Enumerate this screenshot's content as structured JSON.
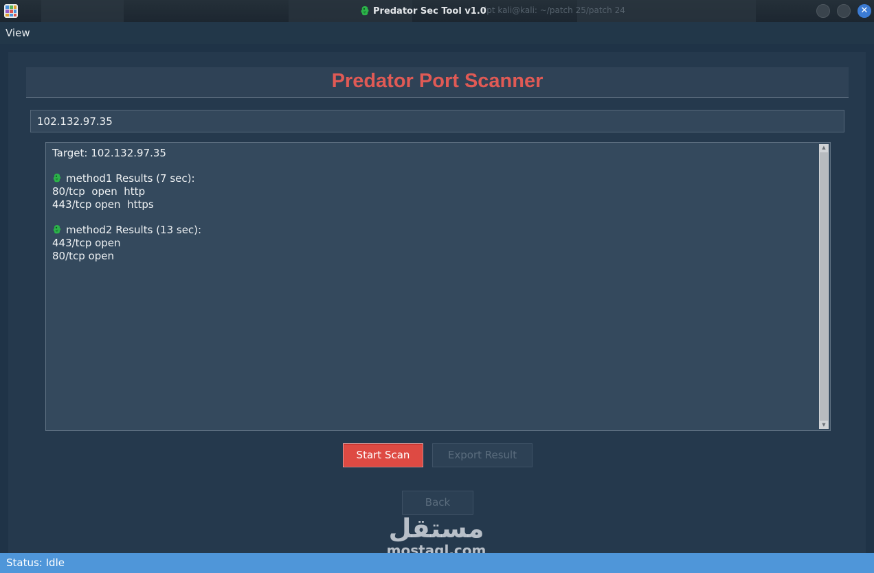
{
  "window": {
    "title": "Predator Sec Tool v1.0",
    "background_title": "ript kali@kali: ~/patch 25/patch 24",
    "close_glyph": "✕"
  },
  "menu": {
    "items": [
      {
        "label": "View"
      }
    ]
  },
  "app": {
    "heading": "Predator Port Scanner"
  },
  "target": {
    "value": "102.132.97.35"
  },
  "output": {
    "lines": [
      {
        "text": "Target: 102.132.97.35",
        "icon": null
      },
      {
        "text": "",
        "icon": null
      },
      {
        "text": "method1 Results (7 sec):",
        "icon": "dragon-icon"
      },
      {
        "text": "80/tcp  open  http",
        "icon": null
      },
      {
        "text": "443/tcp open  https",
        "icon": null
      },
      {
        "text": "",
        "icon": null
      },
      {
        "text": "method2 Results (13 sec):",
        "icon": "dragon-icon"
      },
      {
        "text": "443/tcp open",
        "icon": null
      },
      {
        "text": "80/tcp open",
        "icon": null
      }
    ]
  },
  "buttons": {
    "start_scan": "Start Scan",
    "export_result": "Export Result",
    "back": "Back"
  },
  "status": {
    "text": "Status: Idle"
  },
  "watermark": {
    "arabic": "مستقل",
    "latin": "mostaql.com"
  },
  "colors": {
    "heading": "#e05a55",
    "start_scan_bg": "#de4a43",
    "statusbar_bg": "#4f96d9",
    "panel_bg": "#25394d",
    "output_bg": "#34495d",
    "dragon": "#2cb34a"
  }
}
